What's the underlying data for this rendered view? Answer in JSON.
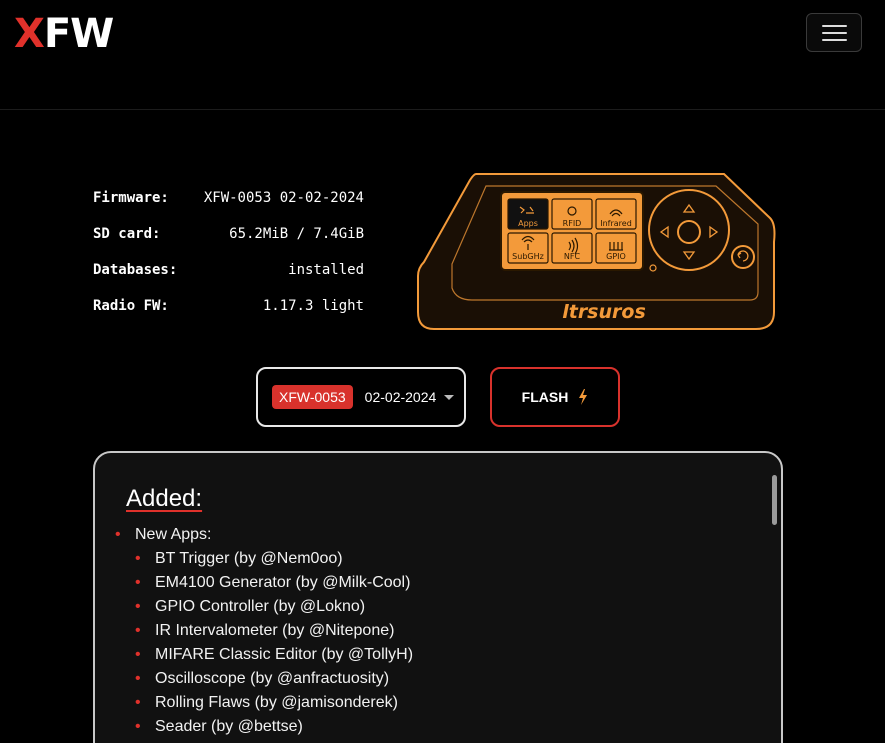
{
  "brand": {
    "logo_x": "X",
    "logo_fw": "FW"
  },
  "info": {
    "rows": [
      {
        "key": "Firmware:",
        "value": "XFW-0053 02-02-2024"
      },
      {
        "key": "SD card:",
        "value": "65.2MiB / 7.4GiB"
      },
      {
        "key": "Databases:",
        "value": "installed"
      },
      {
        "key": "Radio FW:",
        "value": "1.17.3 light"
      }
    ]
  },
  "device": {
    "name": "ltrsuros",
    "apps": [
      "Apps",
      "RFID",
      "Infrared",
      "SubGHz",
      "NFC",
      "GPIO"
    ],
    "accent": "#f39a3a"
  },
  "firmware_select": {
    "badge": "XFW-0053",
    "date": "02-02-2024"
  },
  "flash": {
    "label": "FLASH"
  },
  "changelog": {
    "title": "Added:",
    "group": "New Apps:",
    "items": [
      "BT Trigger (by @Nem0oo)",
      "EM4100 Generator (by @Milk-Cool)",
      "GPIO Controller (by @Lokno)",
      "IR Intervalometer (by @Nitepone)",
      "MIFARE Classic Editor (by @TollyH)",
      "Oscilloscope (by @anfractuosity)",
      "Rolling Flaws (by @jamisonderek)",
      "Seader (by @bettse)"
    ]
  },
  "colors": {
    "brand_red": "#e0312b",
    "device_orange": "#f39a3a"
  }
}
